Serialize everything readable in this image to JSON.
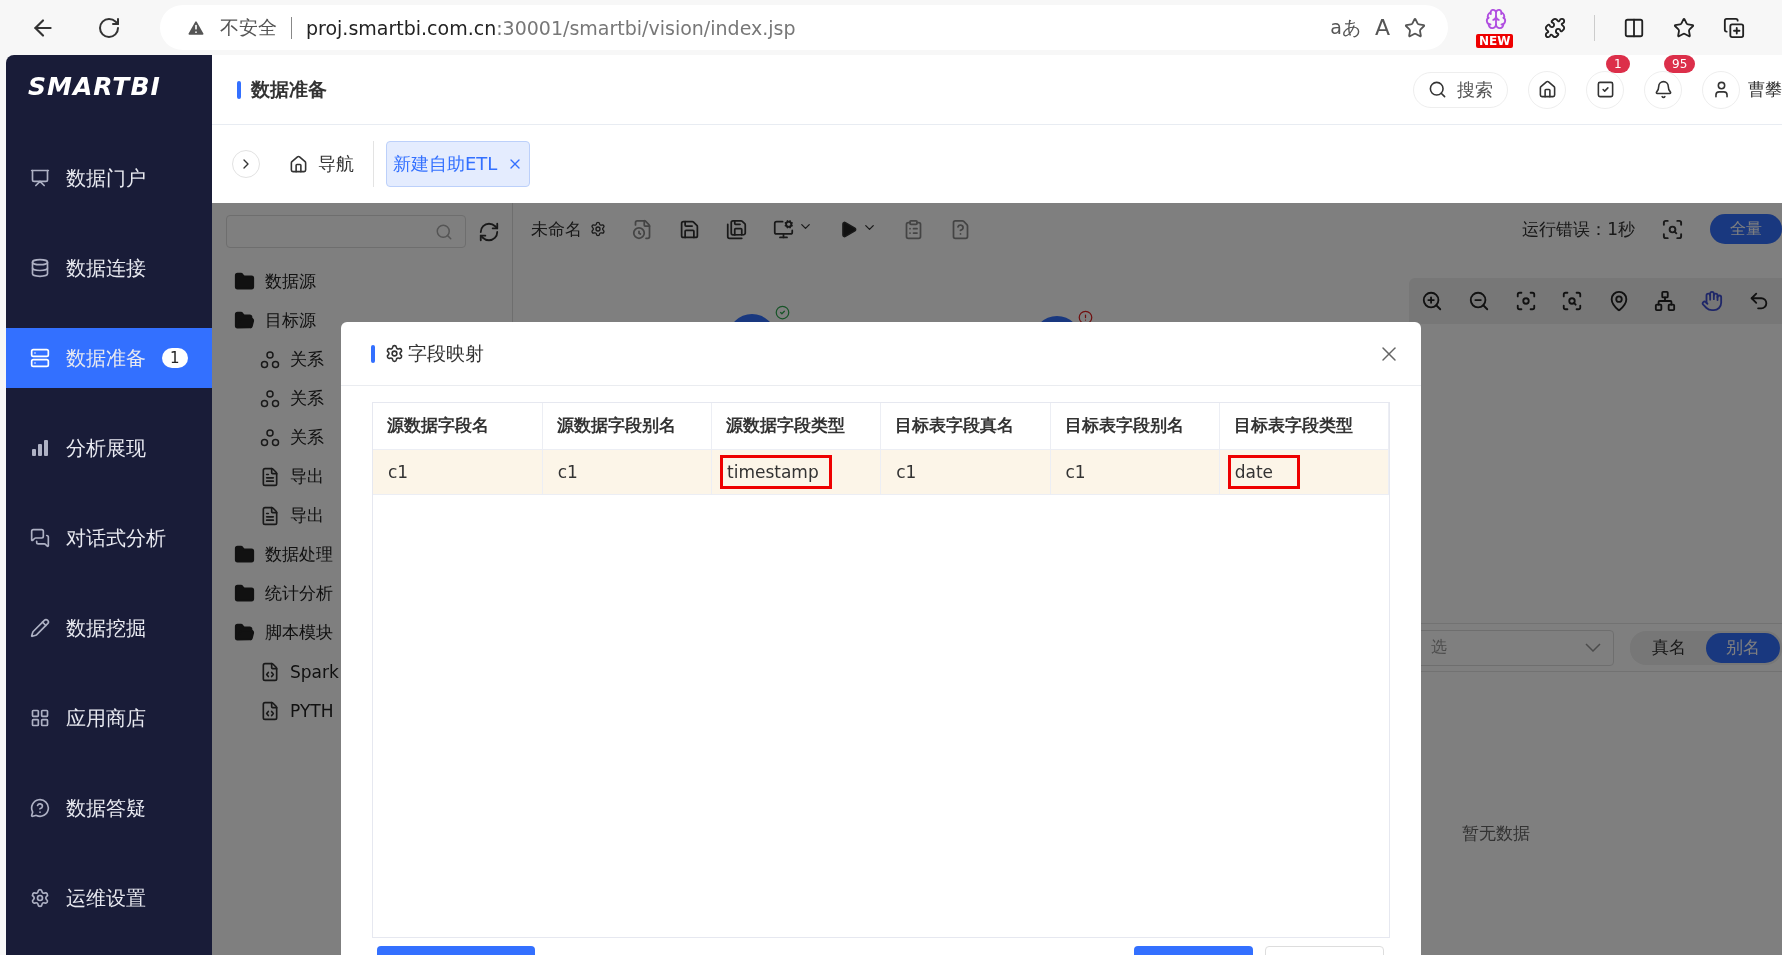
{
  "browser": {
    "security_label": "不安全",
    "url": {
      "host": "proj.smartbi.com.cn",
      "path": ":30001/smartbi/vision/index.jsp"
    },
    "translate_label": "aあ",
    "read_aloud_label": "A",
    "extension_badge": "NEW"
  },
  "sidebar": {
    "logo": "SMARTBI",
    "items": [
      {
        "label": "数据门户",
        "selected": false
      },
      {
        "label": "数据连接",
        "selected": false
      },
      {
        "label": "数据准备",
        "selected": true,
        "badge": "1"
      },
      {
        "label": "分析展现",
        "selected": false
      },
      {
        "label": "对话式分析",
        "selected": false
      },
      {
        "label": "数据挖掘",
        "selected": false
      },
      {
        "label": "应用商店",
        "selected": false
      },
      {
        "label": "数据答疑",
        "selected": false
      },
      {
        "label": "运维设置",
        "selected": false
      }
    ]
  },
  "header": {
    "title": "数据准备",
    "search_label": "搜索",
    "task_badge": "1",
    "notification_badge": "95",
    "user_name": "曹攀"
  },
  "tabs": [
    {
      "label": "导航",
      "kind": "home",
      "selected": false
    },
    {
      "label": "新建自助ETL",
      "kind": "closable",
      "selected": true
    }
  ],
  "tree": [
    {
      "label": "数据源",
      "kind": "folder",
      "expanded": false
    },
    {
      "label": "目标源",
      "kind": "folder",
      "expanded": true,
      "children": [
        {
          "label": "关系",
          "kind": "relation"
        },
        {
          "label": "关系",
          "kind": "relation"
        },
        {
          "label": "关系",
          "kind": "relation"
        },
        {
          "label": "导出",
          "kind": "export"
        },
        {
          "label": "导出",
          "kind": "export"
        }
      ]
    },
    {
      "label": "数据处理",
      "kind": "folder",
      "expanded": false
    },
    {
      "label": "统计分析",
      "kind": "folder",
      "expanded": false
    },
    {
      "label": "脚本模块",
      "kind": "folder",
      "expanded": true,
      "children": [
        {
          "label": "Spark",
          "kind": "sql"
        },
        {
          "label": "PYTH",
          "kind": "python"
        }
      ]
    }
  ],
  "editor": {
    "name": "未命名",
    "run_status": "运行错误：1秒",
    "mode_toggle": [
      {
        "label": "全量",
        "selected": true
      }
    ]
  },
  "canvas": {
    "nodes": [
      {
        "kind": "success"
      },
      {
        "kind": "error"
      }
    ]
  },
  "properties": {
    "select": {
      "placeholder": "选"
    },
    "name_toggle": [
      {
        "label": "真名",
        "selected": false
      },
      {
        "label": "别名",
        "selected": true
      }
    ],
    "empty_text": "暂无数据"
  },
  "dialog": {
    "title": "字段映射",
    "columns": [
      "源数据字段名",
      "源数据字段别名",
      "源数据字段类型",
      "目标表字段真名",
      "目标表字段别名",
      "目标表字段类型"
    ],
    "rows": [
      {
        "selected": true,
        "cells": [
          {
            "text": "c1",
            "highlighted": false
          },
          {
            "text": "c1",
            "highlighted": false
          },
          {
            "text": "timestamp",
            "highlighted": true
          },
          {
            "text": "c1",
            "highlighted": false
          },
          {
            "text": "c1",
            "highlighted": false
          },
          {
            "text": "date",
            "highlighted": true
          }
        ]
      }
    ]
  }
}
